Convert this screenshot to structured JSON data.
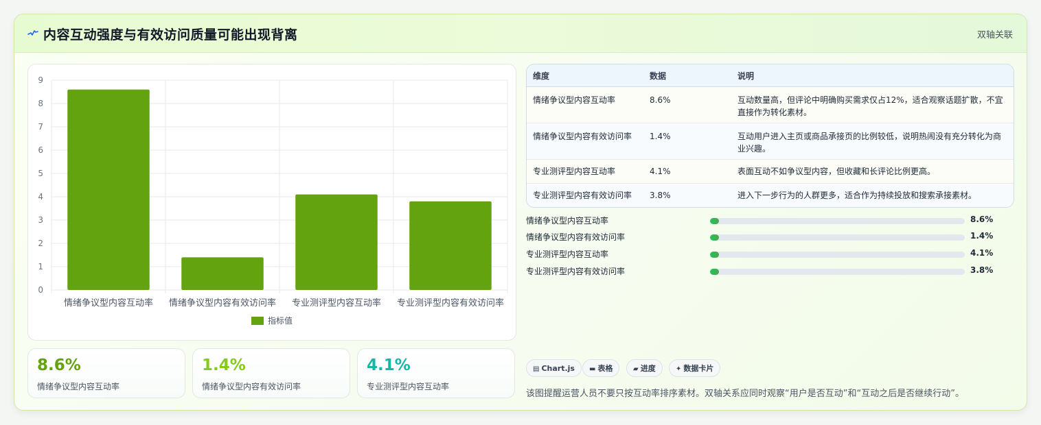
{
  "header": {
    "title": "内容互动强度与有效访问质量可能出现背离",
    "badge": "双轴关联",
    "icon": "pulse-icon"
  },
  "chart_data": {
    "type": "bar",
    "categories": [
      "情绪争议型内容互动率",
      "情绪争议型内容有效访问率",
      "专业测评型内容互动率",
      "专业测评型内容有效访问率"
    ],
    "series": [
      {
        "name": "指标值",
        "values": [
          8.6,
          1.4,
          4.1,
          3.8
        ],
        "color": "#63a30f"
      }
    ],
    "ylim": [
      0,
      9
    ],
    "yticks": [
      0,
      1,
      2,
      3,
      4,
      5,
      6,
      7,
      8,
      9
    ],
    "grid": true,
    "legend": "bottom"
  },
  "kpis": [
    {
      "value": "8.6%",
      "label": "情绪争议型内容互动率",
      "color": "#65a30d"
    },
    {
      "value": "1.4%",
      "label": "情绪争议型内容有效访问率",
      "color": "#84cc16"
    },
    {
      "value": "4.1%",
      "label": "专业测评型内容互动率",
      "color": "#14b8a6"
    }
  ],
  "table": {
    "headers": [
      "维度",
      "数据",
      "说明"
    ],
    "rows": [
      {
        "dim": "情绪争议型内容互动率",
        "val": "8.6%",
        "desc": "互动数量高，但评论中明确购买需求仅占12%，适合观察话题扩散，不宜直接作为转化素材。"
      },
      {
        "dim": "情绪争议型内容有效访问率",
        "val": "1.4%",
        "desc": "互动用户进入主页或商品承接页的比例较低，说明热闹没有充分转化为商业兴趣。"
      },
      {
        "dim": "专业测评型内容互动率",
        "val": "4.1%",
        "desc": "表面互动不如争议型内容，但收藏和长评论比例更高。"
      },
      {
        "dim": "专业测评型内容有效访问率",
        "val": "3.8%",
        "desc": "进入下一步行为的人群更多，适合作为持续投放和搜索承接素材。"
      }
    ]
  },
  "progress": [
    {
      "label": "情绪争议型内容互动率",
      "value": "8.6%",
      "fraction": 0.01
    },
    {
      "label": "情绪争议型内容有效访问率",
      "value": "1.4%",
      "fraction": 0.01
    },
    {
      "label": "专业测评型内容互动率",
      "value": "4.1%",
      "fraction": 0.01
    },
    {
      "label": "专业测评型内容有效访问率",
      "value": "3.8%",
      "fraction": 0.01
    }
  ],
  "chips": [
    {
      "label": "Chart.js",
      "icon": "chart-icon"
    },
    {
      "label": "表格",
      "icon": "table-icon"
    },
    {
      "label": "进度",
      "icon": "progress-icon"
    },
    {
      "label": "数据卡片",
      "icon": "sparkle-icon"
    }
  ],
  "note": "该图提醒运营人员不要只按互动率排序素材。双轴关系应同时观察“用户是否互动”和“互动之后是否继续行动”。"
}
